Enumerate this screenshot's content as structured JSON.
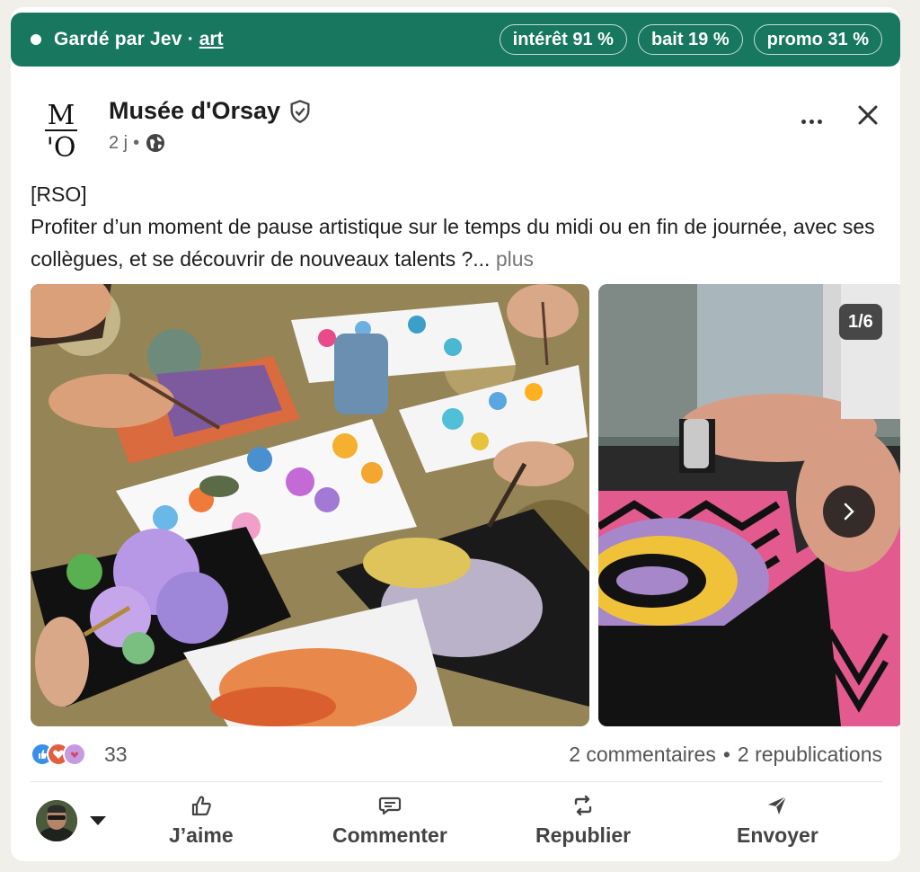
{
  "banner": {
    "kept_by": "Gardé par Jev",
    "separator": "·",
    "topic": "art",
    "scores": [
      {
        "label": "intérêt 91 %"
      },
      {
        "label": "bait 19 %"
      },
      {
        "label": "promo 31 %"
      }
    ]
  },
  "post": {
    "author": "Musée d'Orsay",
    "logo_text": {
      "top": "M",
      "bottom": "'O"
    },
    "age": "2 j",
    "dot": "•",
    "tag": "[RSO]",
    "body": "Profiter d’un moment de pause artistique sur le temps du midi ou en fin de journée, avec ses collègues, et se découvrir de nouveaux talents ?...",
    "see_more": "plus"
  },
  "carousel": {
    "counter": "1/6"
  },
  "stats": {
    "reactions_count": "33",
    "comments": "2 commentaires",
    "bullet": "•",
    "reposts": "2 republications"
  },
  "actions": {
    "like": "J’aime",
    "comment": "Commenter",
    "repost": "Republier",
    "send": "Envoyer"
  },
  "colors": {
    "banner_bg": "#17785f",
    "text": "#1d1d1d",
    "muted": "#666666"
  }
}
